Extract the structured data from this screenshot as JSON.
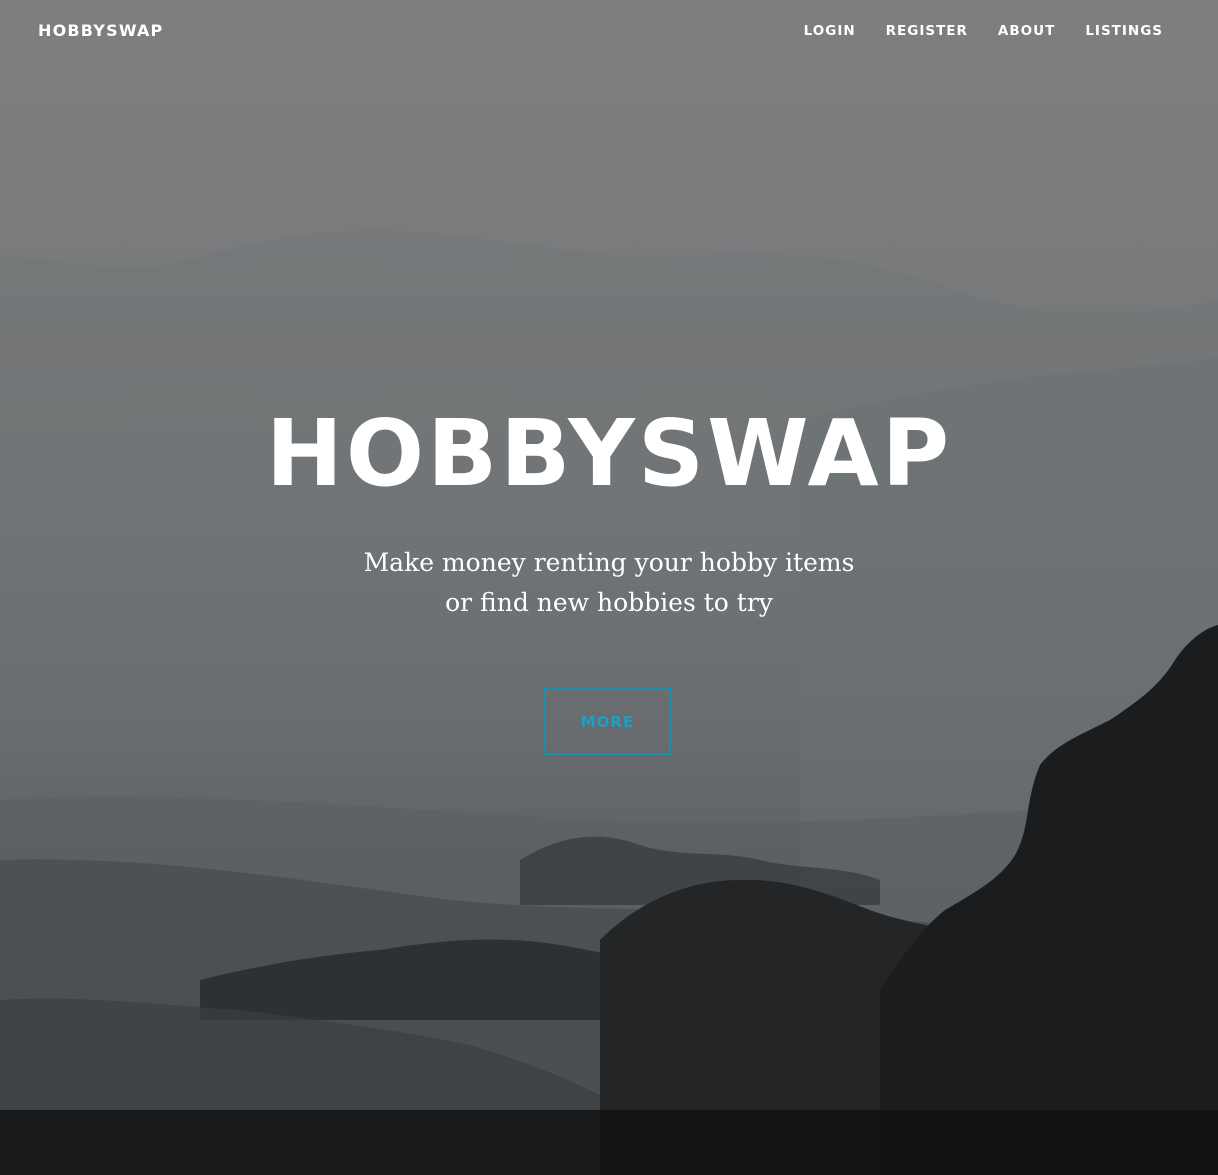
{
  "nav": {
    "brand": "HOBBYSWAP",
    "links": [
      {
        "label": "LOGIN"
      },
      {
        "label": "REGISTER"
      },
      {
        "label": "ABOUT"
      },
      {
        "label": "LISTINGS"
      }
    ]
  },
  "hero": {
    "title": "HOBBYSWAP",
    "subtitle_line1": "Make money renting your hobby items",
    "subtitle_line2": "or find new hobbies to try",
    "button_label": "MORE"
  },
  "colors": {
    "accent": "#1da0c3",
    "text": "#ffffff"
  }
}
